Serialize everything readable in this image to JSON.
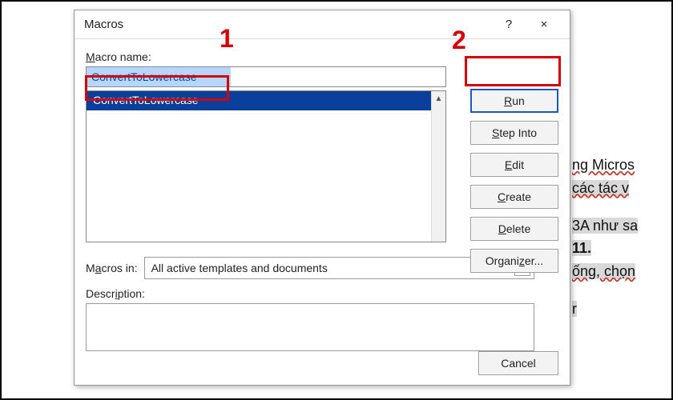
{
  "dialog": {
    "title": "Macros",
    "help_symbol": "?",
    "close_symbol": "×",
    "macro_name_label": "Macro name:",
    "macro_name_value": "ConvertToLowercase",
    "list_selected": "ConvertToLowercase",
    "buttons": {
      "run": "Run",
      "step_into": "Step Into",
      "edit": "Edit",
      "create": "Create",
      "delete": "Delete",
      "organizer": "Organizer...",
      "cancel": "Cancel"
    },
    "macros_in_label": "Macros in:",
    "macros_in_value": "All active templates and documents",
    "description_label": "Description:",
    "description_value": ""
  },
  "annotations": {
    "one": "1",
    "two": "2"
  },
  "bg": {
    "l1": "ng Micros",
    "l2": "các tác v",
    "l3": "3A như sa",
    "l4": "11.",
    "l5": "ống, chọn",
    "l6": "r"
  }
}
